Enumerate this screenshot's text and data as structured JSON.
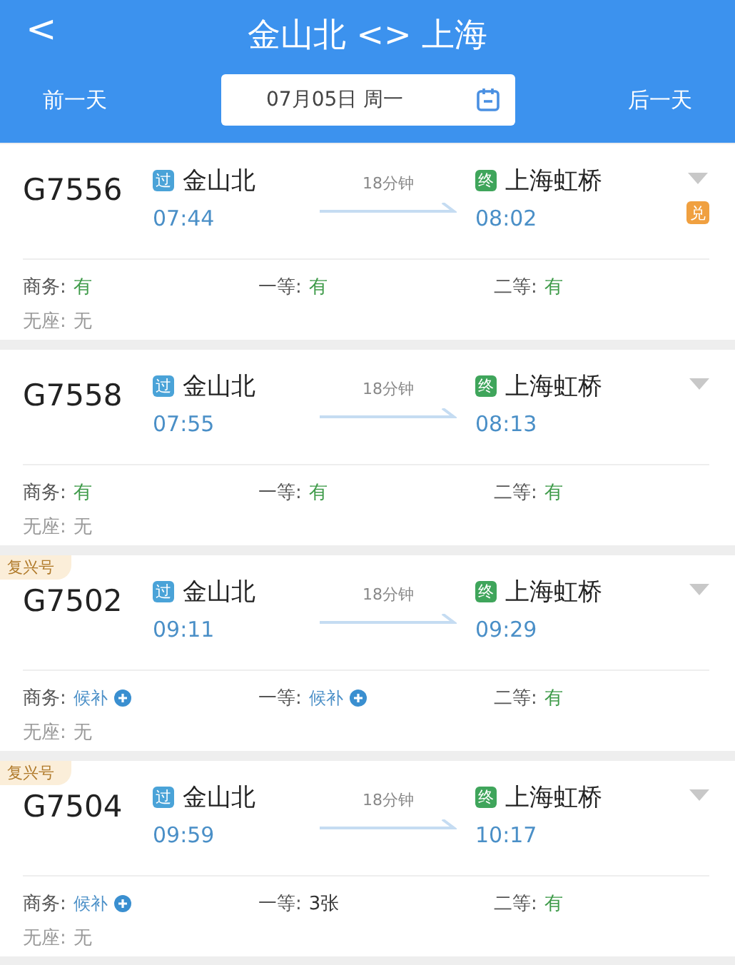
{
  "header": {
    "back": "<",
    "title": "金山北 <> 上海",
    "prev_day": "前一天",
    "date": "07月05日 周一",
    "next_day": "后一天"
  },
  "trains": [
    {
      "number": "G7556",
      "from_badge": "过",
      "from": "金山北",
      "depart": "07:44",
      "duration": "18分钟",
      "to_badge": "终",
      "to": "上海虹桥",
      "arrive": "08:02",
      "exchange": "兑",
      "seats": [
        {
          "label": "商务:",
          "value": "有",
          "kind": "avail"
        },
        {
          "label": "一等:",
          "value": "有",
          "kind": "avail"
        },
        {
          "label": "二等:",
          "value": "有",
          "kind": "avail"
        },
        {
          "label": "无座:",
          "value": "无",
          "kind": "none"
        }
      ]
    },
    {
      "number": "G7558",
      "from_badge": "过",
      "from": "金山北",
      "depart": "07:55",
      "duration": "18分钟",
      "to_badge": "终",
      "to": "上海虹桥",
      "arrive": "08:13",
      "seats": [
        {
          "label": "商务:",
          "value": "有",
          "kind": "avail"
        },
        {
          "label": "一等:",
          "value": "有",
          "kind": "avail"
        },
        {
          "label": "二等:",
          "value": "有",
          "kind": "avail"
        },
        {
          "label": "无座:",
          "value": "无",
          "kind": "none"
        }
      ]
    },
    {
      "tag": "复兴号",
      "number": "G7502",
      "from_badge": "过",
      "from": "金山北",
      "depart": "09:11",
      "duration": "18分钟",
      "to_badge": "终",
      "to": "上海虹桥",
      "arrive": "09:29",
      "seats": [
        {
          "label": "商务:",
          "value": "候补",
          "kind": "waitlist"
        },
        {
          "label": "一等:",
          "value": "候补",
          "kind": "waitlist"
        },
        {
          "label": "二等:",
          "value": "有",
          "kind": "avail"
        },
        {
          "label": "无座:",
          "value": "无",
          "kind": "none"
        }
      ]
    },
    {
      "tag": "复兴号",
      "number": "G7504",
      "from_badge": "过",
      "from": "金山北",
      "depart": "09:59",
      "duration": "18分钟",
      "to_badge": "终",
      "to": "上海虹桥",
      "arrive": "10:17",
      "seats": [
        {
          "label": "商务:",
          "value": "候补",
          "kind": "waitlist"
        },
        {
          "label": "一等:",
          "value": "3张",
          "kind": "count"
        },
        {
          "label": "二等:",
          "value": "有",
          "kind": "avail"
        },
        {
          "label": "无座:",
          "value": "无",
          "kind": "none"
        }
      ]
    }
  ]
}
